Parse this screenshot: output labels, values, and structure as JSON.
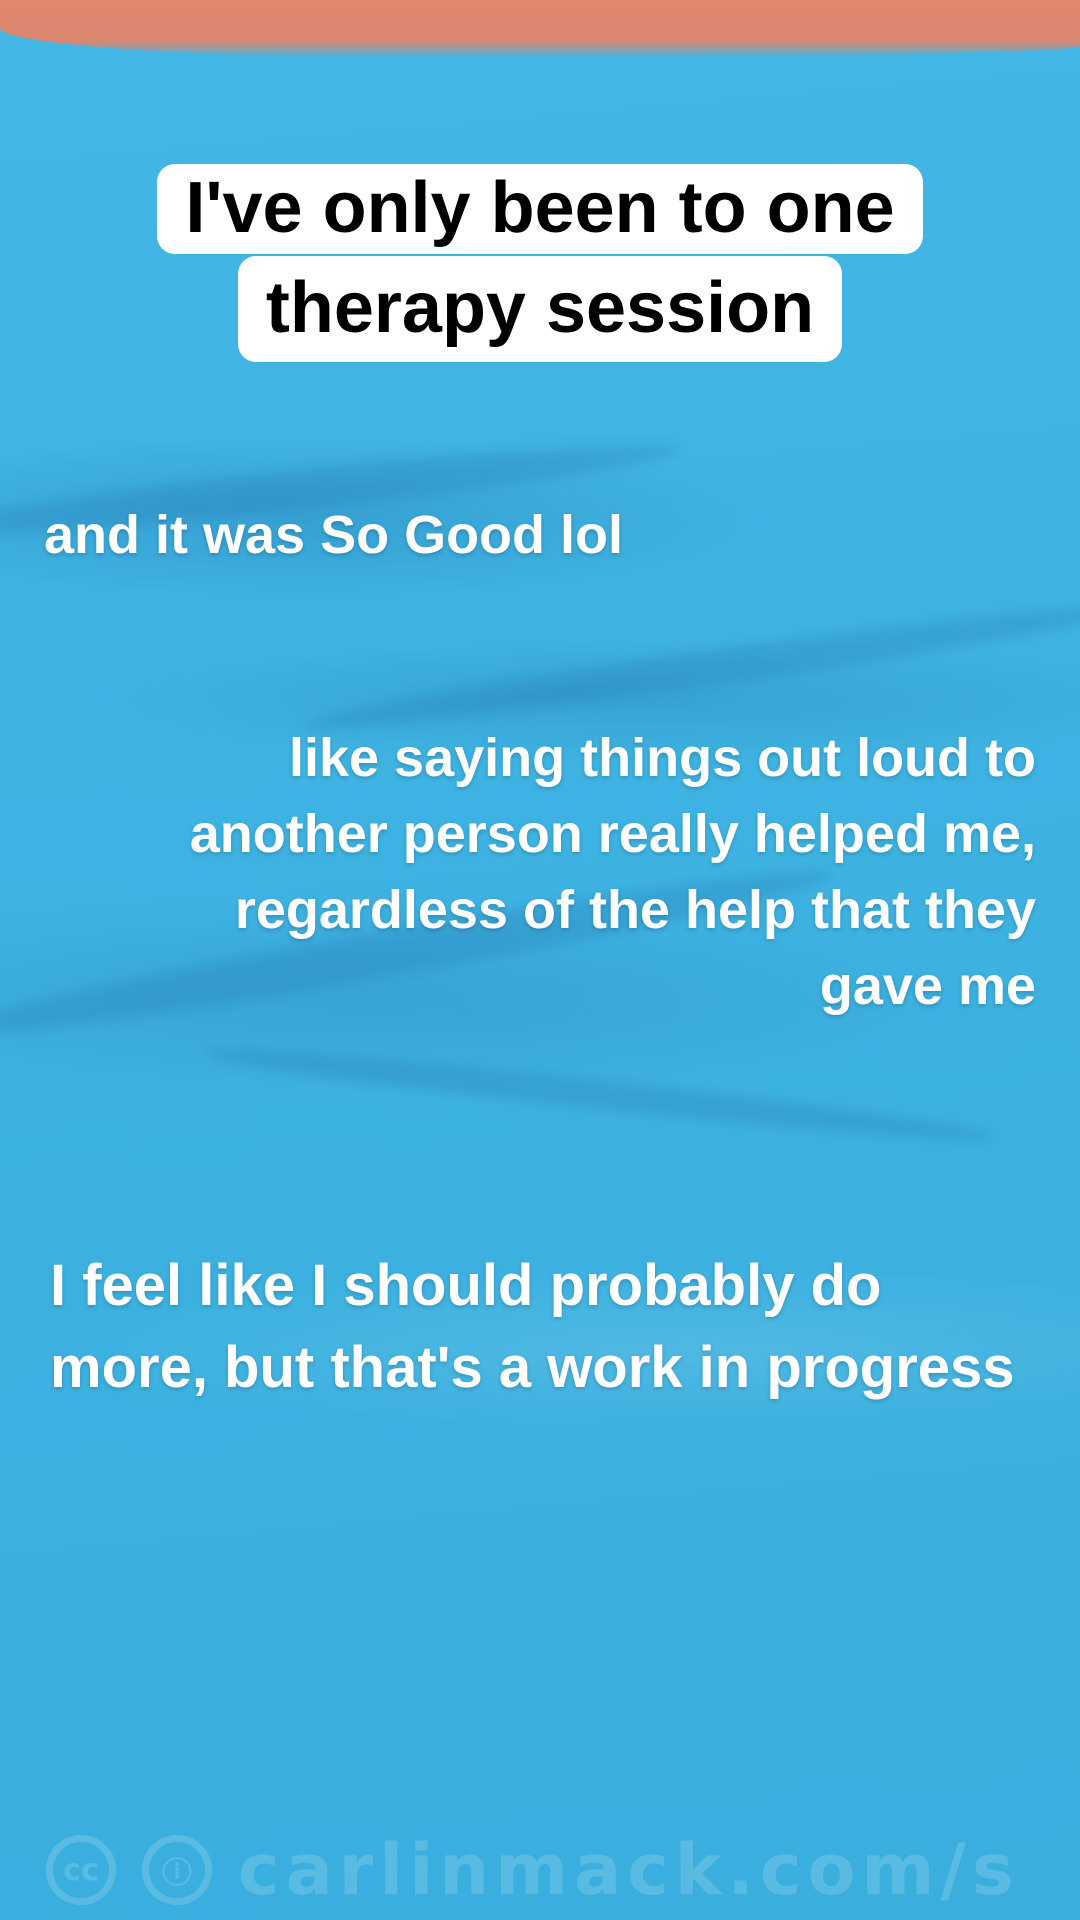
{
  "caption": {
    "line1": "I've only been to one",
    "line2": "therapy session"
  },
  "texts": {
    "line_a": "and it was So Good lol",
    "line_b": "like saying things out loud to another person really helped me, regardless of the help that they gave me",
    "line_c": "I feel like I should probably do more, but that's a work in progress"
  },
  "watermark": {
    "cc_icon": "cc-license-icon",
    "attribution_icon": "attribution-icon",
    "cc_glyph": "cc",
    "attribution_glyph": "ⓘ",
    "url": "carlinmack.com/s"
  },
  "colors": {
    "background": "#3eb3e2",
    "top_band": "#e3866f",
    "caption_box": "#ffffff",
    "caption_text": "#000000",
    "body_text": "#ffffff"
  }
}
